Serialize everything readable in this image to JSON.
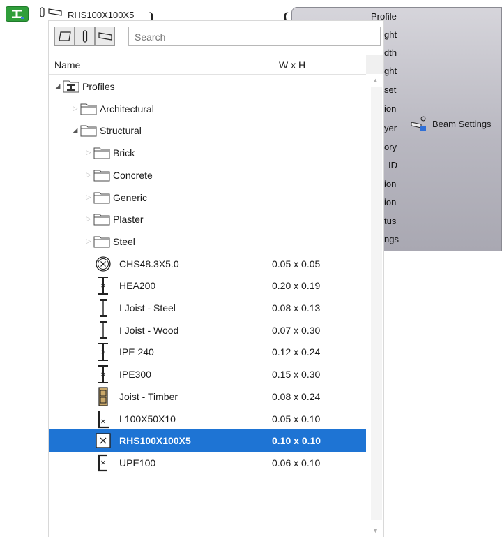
{
  "toolbar": {
    "current_profile": "RHS100X100X5"
  },
  "properties_panel": {
    "labels": [
      "Profile",
      "ght",
      "dth",
      "ght",
      "set",
      "ion",
      "yer",
      "ory",
      "ID",
      "ion",
      "ion",
      "tus",
      "ngs"
    ],
    "beam_settings_label": "Beam Settings"
  },
  "picker": {
    "search_placeholder": "Search",
    "columns": {
      "name": "Name",
      "size": "W x H"
    },
    "tree": [
      {
        "label": "Profiles",
        "level": 0,
        "expander": "expanded",
        "kind": "root"
      },
      {
        "label": "Architectural",
        "level": 1,
        "expander": "collapsed",
        "kind": "folder"
      },
      {
        "label": "Structural",
        "level": 1,
        "expander": "expanded",
        "kind": "folder"
      },
      {
        "label": "Brick",
        "level": 2,
        "expander": "collapsed",
        "kind": "folder"
      },
      {
        "label": "Concrete",
        "level": 2,
        "expander": "collapsed",
        "kind": "folder"
      },
      {
        "label": "Generic",
        "level": 2,
        "expander": "collapsed",
        "kind": "folder"
      },
      {
        "label": "Plaster",
        "level": 2,
        "expander": "collapsed",
        "kind": "folder"
      },
      {
        "label": "Steel",
        "level": 2,
        "expander": "collapsed",
        "kind": "folder"
      },
      {
        "label": "CHS48.3X5.0",
        "size": "0.05 x 0.05",
        "icon": "circular-hollow-section-icon",
        "kind": "profile"
      },
      {
        "label": "HEA200",
        "size": "0.20 x 0.19",
        "icon": "i-beam-icon",
        "kind": "profile"
      },
      {
        "label": "I Joist - Steel",
        "size": "0.08 x 0.13",
        "icon": "i-joist-icon",
        "kind": "profile"
      },
      {
        "label": "I Joist - Wood",
        "size": "0.07 x 0.30",
        "icon": "i-joist-icon",
        "kind": "profile"
      },
      {
        "label": "IPE 240",
        "size": "0.12 x 0.24",
        "icon": "i-beam-icon",
        "kind": "profile"
      },
      {
        "label": "IPE300",
        "size": "0.15 x 0.30",
        "icon": "i-beam-icon",
        "kind": "profile"
      },
      {
        "label": "Joist - Timber",
        "size": "0.08 x 0.24",
        "icon": "timber-joist-icon",
        "kind": "profile"
      },
      {
        "label": "L100X50X10",
        "size": "0.05 x 0.10",
        "icon": "angle-section-icon",
        "kind": "profile"
      },
      {
        "label": "RHS100X100X5",
        "size": "0.10 x 0.10",
        "icon": "rectangular-hollow-section-icon",
        "kind": "profile",
        "selected": true
      },
      {
        "label": "UPE100",
        "size": "0.06 x 0.10",
        "icon": "channel-section-icon",
        "kind": "profile"
      }
    ]
  },
  "colors": {
    "selection": "#1e74d4",
    "tool_button": "#2f9e3a",
    "panel": "#b8b7c0"
  }
}
